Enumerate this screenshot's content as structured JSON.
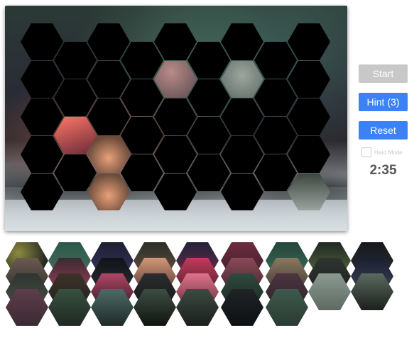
{
  "controls": {
    "start_label": "Start",
    "hint_label": "Hint (3)",
    "reset_label": "Reset",
    "hard_mode_label": "Hard Mode",
    "hard_mode_checked": false,
    "timer": "2:35"
  },
  "colors": {
    "primary": "#3b82f6",
    "disabled": "#c8c8c8",
    "timer_text": "#555555"
  }
}
